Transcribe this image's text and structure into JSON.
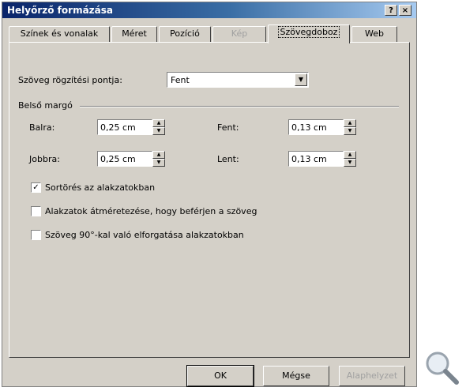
{
  "window": {
    "title": "Helyőrző formázása"
  },
  "title_buttons": {
    "help": "?",
    "close": "×"
  },
  "tabs": [
    {
      "label": "Színek és vonalak",
      "state": "normal"
    },
    {
      "label": "Méret",
      "state": "normal"
    },
    {
      "label": "Pozíció",
      "state": "normal"
    },
    {
      "label": "Kép",
      "state": "disabled"
    },
    {
      "label": "Szövegdoboz",
      "state": "active"
    },
    {
      "label": "Web",
      "state": "normal"
    }
  ],
  "anchor": {
    "label": "Szöveg rögzítési pontja:",
    "value": "Fent"
  },
  "margins": {
    "group_label": "Belső margó",
    "left_label": "Balra:",
    "left_value": "0,25 cm",
    "right_label": "Jobbra:",
    "right_value": "0,25 cm",
    "top_label": "Fent:",
    "top_value": "0,13 cm",
    "bottom_label": "Lent:",
    "bottom_value": "0,13 cm"
  },
  "checkboxes": [
    {
      "label": "Sortörés az alakzatokban",
      "checked": true
    },
    {
      "label": "Alakzatok átméretezése, hogy beférjen a szöveg",
      "checked": false
    },
    {
      "label": "Szöveg 90°-kal való elforgatása alakzatokban",
      "checked": false
    }
  ],
  "buttons": {
    "ok": "OK",
    "cancel": "Mégse",
    "reset": "Alaphelyzet"
  },
  "icons": {
    "zoom": "magnifier-icon"
  }
}
